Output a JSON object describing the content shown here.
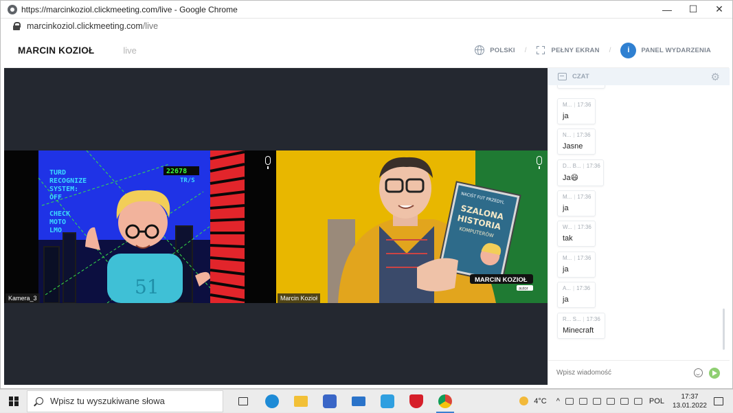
{
  "browser": {
    "title": "https://marcinkoziol.clickmeeting.com/live - Google Chrome",
    "url_host": "marcinkoziol.clickmeeting.com",
    "url_path": "/live",
    "controls": {
      "minimize": "—",
      "maximize": "☐",
      "close": "✕"
    }
  },
  "header": {
    "brand": "MARCIN KOZIOŁ",
    "live": "live",
    "language": "POLSKI",
    "fullscreen": "PEŁNY EKRAN",
    "panel_badge": "i",
    "panel": "PANEL WYDARZENIA"
  },
  "videos": [
    {
      "label": "Kamera_3"
    },
    {
      "label": "Marcin Kozioł",
      "overlay_name": "MARCIN KOZIOŁ",
      "overlay_role": "autor"
    }
  ],
  "game_screen": {
    "lines": [
      "TURD",
      "RECOGNIZE",
      "SYSTEM:",
      "OFF",
      "",
      "CHECK",
      "MOTO",
      "LMO"
    ],
    "counter": "22678",
    "unit": "TR/S"
  },
  "book": {
    "top": "NACIŚT FUT PRZEDYL",
    "title": [
      "SZALONA",
      "HISTORIA",
      "KOMPUTERÓW"
    ]
  },
  "chat": {
    "title": "CZAT",
    "partial_top": "tak",
    "messages": [
      {
        "author": "M...",
        "time": "17:36",
        "text": "ja"
      },
      {
        "author": "N...",
        "time": "17:36",
        "text": "Jasne"
      },
      {
        "author": "D... B...",
        "time": "17:36",
        "text": "Ja😄"
      },
      {
        "author": "M...",
        "time": "17:36",
        "text": "ja"
      },
      {
        "author": "W...",
        "time": "17:36",
        "text": "tak"
      },
      {
        "author": "M...",
        "time": "17:36",
        "text": "ja"
      },
      {
        "author": "A...",
        "time": "17:36",
        "text": "ja"
      },
      {
        "author": "R... S...",
        "time": "17:36",
        "text": "Minecraft"
      }
    ],
    "input_placeholder": "Wpisz wiadomość"
  },
  "taskbar": {
    "search_placeholder": "Wpisz tu wyszukiwane słowa",
    "weather": "4°C",
    "language": "POL",
    "time": "17:37",
    "date": "13.01.2022",
    "apps": [
      "task-view",
      "edge",
      "file-explorer",
      "store",
      "mail",
      "l-app",
      "mcafee",
      "chrome"
    ]
  },
  "colors": {
    "accent": "#2f80d1",
    "stage": "#242830",
    "chat_header": "#eef3f8",
    "send": "#8fcf72",
    "video_bg": "#e8b700"
  }
}
